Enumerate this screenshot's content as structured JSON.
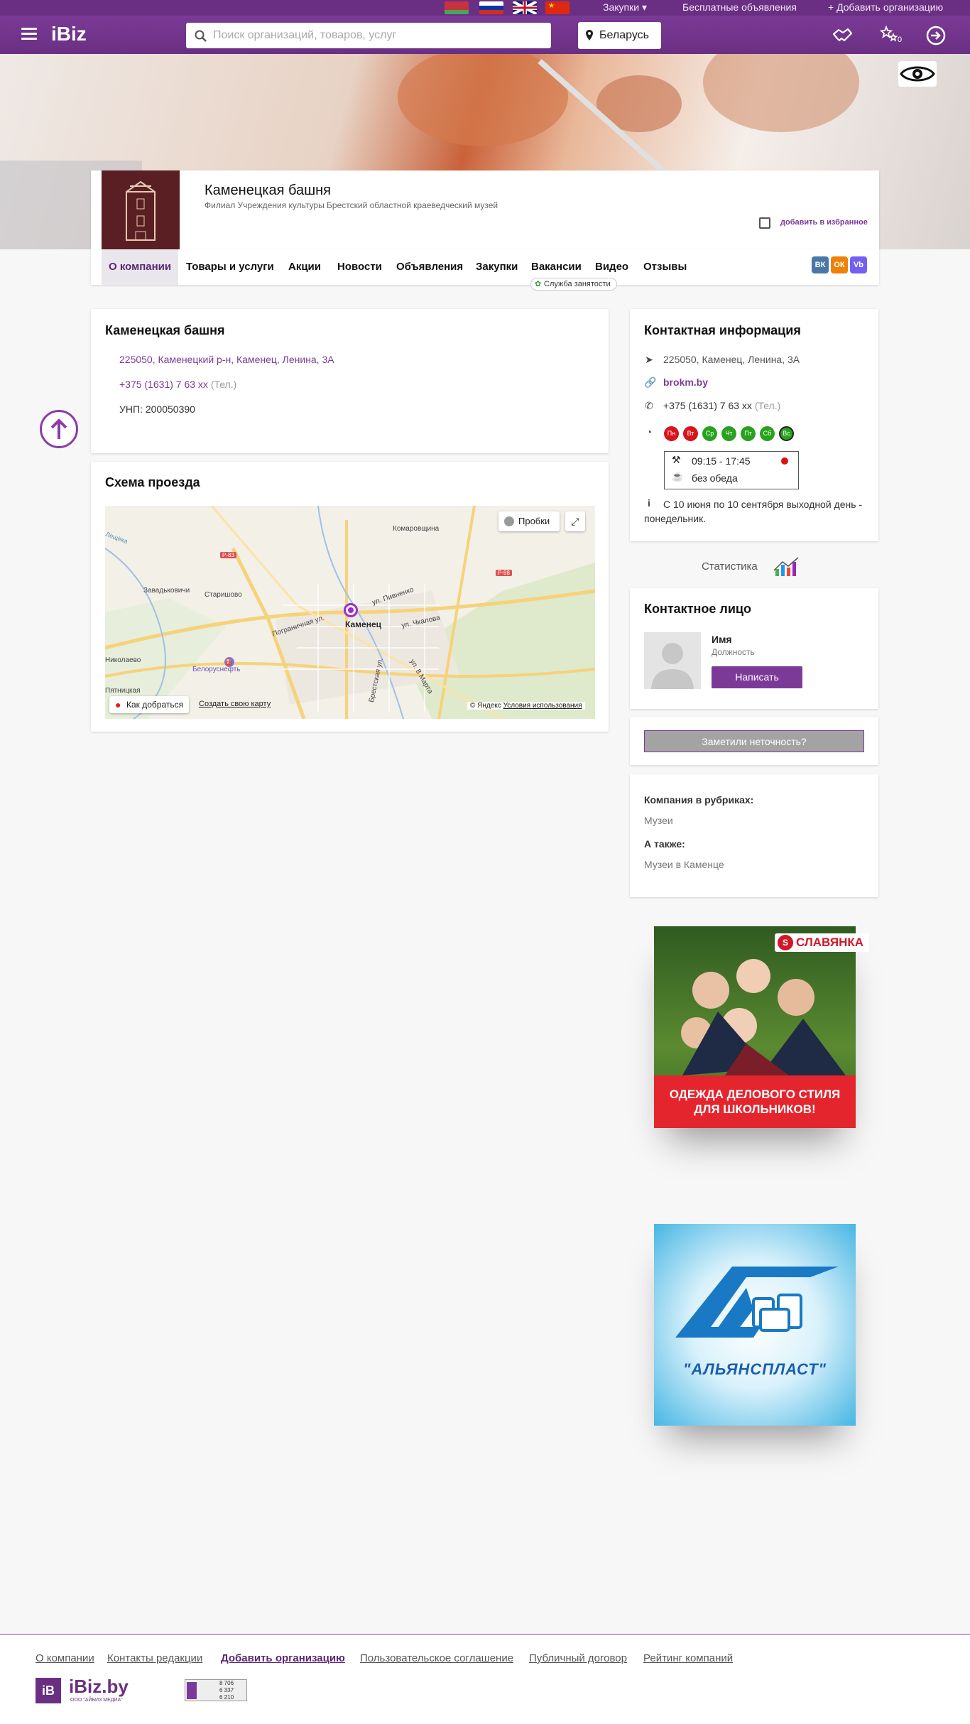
{
  "topstrip": {
    "languages": [
      "be-flag-icon",
      "ru-flag-icon",
      "en-flag-icon",
      "cn-flag-icon"
    ],
    "purchases": "Закупки",
    "free_ads": "Бесплатные объявления",
    "add_org": "Добавить организацию"
  },
  "header": {
    "logo": "iBiz",
    "search_placeholder": "Поиск организаций, товаров, услуг",
    "region": "Беларусь",
    "favorites_count": "0",
    "accent": "#6a2f83"
  },
  "company": {
    "name": "Каменецкая башня",
    "subtitle": "Филиал Учреждения культуры Брестский областной краеведческий музей",
    "favorite_label": "добавить в избранное"
  },
  "tabs": [
    {
      "label": "О компании",
      "active": true
    },
    {
      "label": "Товары и услуги"
    },
    {
      "label": "Акции"
    },
    {
      "label": "Новости"
    },
    {
      "label": "Объявления"
    },
    {
      "label": "Закупки"
    },
    {
      "label": "Вакансии"
    },
    {
      "label": "Видео"
    },
    {
      "label": "Отзывы"
    }
  ],
  "jobs_badge": "Служба занятости",
  "social": [
    "ВК",
    "ОК",
    "Vb"
  ],
  "about": {
    "title": "Каменецкая башня",
    "address": "225050, Каменецкий р-н, Каменец, Ленина, 3А",
    "phone": "+375 (1631) 7 63 xx",
    "phone_type": "(Тел.)",
    "unp": "УНП: 200050390"
  },
  "route": {
    "title": "Схема проезда",
    "traffic": "Пробки",
    "get_there": "Как добраться",
    "create_map": "Создать свою карту",
    "copyright": "© Яндекс",
    "terms": "Условия использования",
    "labels": {
      "komarovshchina": "Комаровщина",
      "zavadskovichi": "Завадьковичи",
      "starishovo": "Старишово",
      "kamenets": "Каменец",
      "pogranichnaya": "Пограничная ул.",
      "pivnenko": "ул. Пивненко",
      "chkalova": "ул. Чкалова",
      "brestskaya": "Брестская ул.",
      "marta": "ул. 8 Марта",
      "nikolaevo": "Николаево",
      "pyatnitskaya": "Пятницкая",
      "belorusneft": "Белоруснефть",
      "r83": "Р-83",
      "r98": "Р-98",
      "leshcheka": "Лещёка"
    }
  },
  "contacts": {
    "title": "Контактная информация",
    "address": "225050, Каменец, Ленина, 3А",
    "site": "brokm.by",
    "phone": "+375 (1631) 7 63 xx",
    "phone_type": "(Тел.)",
    "days": [
      {
        "label": "Пн",
        "color": "#d8141b"
      },
      {
        "label": "Вт",
        "color": "#d8141b"
      },
      {
        "label": "Ср",
        "color": "#28a21e"
      },
      {
        "label": "Чт",
        "color": "#28a21e"
      },
      {
        "label": "Пт",
        "color": "#28a21e"
      },
      {
        "label": "Сб",
        "color": "#28a21e"
      },
      {
        "label": "Вс",
        "color": "#28a21e"
      }
    ],
    "hours": "09:15 - 17:45",
    "lunch": "без обеда",
    "note": "С 10 июня по 10 сентября выходной день - понедельник."
  },
  "stats": {
    "label": "Статистика"
  },
  "person": {
    "title": "Контактное лицо",
    "name": "Имя",
    "position": "Должность",
    "write": "Написать"
  },
  "error_button": "Заметили неточность?",
  "rubrics": {
    "title": "Компания в рубриках:",
    "item": "Музеи",
    "also_title": "А также:",
    "also_item": "Музеи в Каменце"
  },
  "ads": {
    "slavyanka_brand": "СЛАВЯНКА",
    "slavyanka_text": "ОДЕЖДА ДЕЛОВОГО СТИЛЯ ДЛЯ ШКОЛЬНИКОВ!",
    "alians_name": "\"АЛЬЯНСПЛАСТ\""
  },
  "footer": {
    "links": [
      "О компании",
      "Контакты редакции",
      "Добавить организацию",
      "Пользовательское соглашение",
      "Публичный договор",
      "Рейтинг компаний"
    ],
    "logo": "iBiz.by",
    "logo_sub": "ООО \"АЙБИЗ МЕДИА\"",
    "counter": [
      "8 706",
      "6 337",
      "6 210"
    ]
  }
}
